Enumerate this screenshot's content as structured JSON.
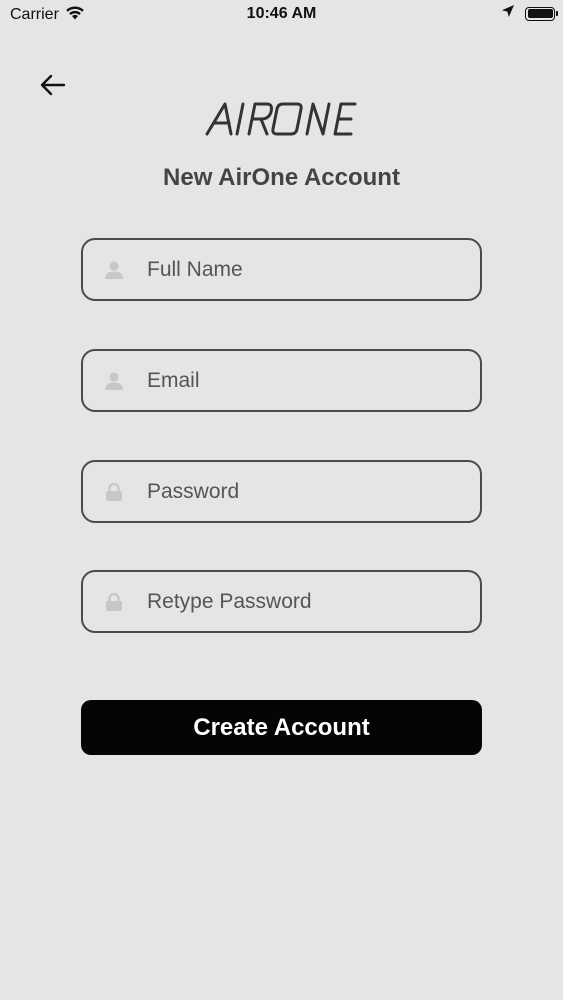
{
  "status_bar": {
    "carrier": "Carrier",
    "time": "10:46 AM",
    "wifi_icon": "wifi-icon",
    "location_icon": "location-arrow-icon",
    "battery_icon": "battery-full-icon"
  },
  "header": {
    "back_icon": "arrow-left-icon",
    "logo_text": "AIRONE",
    "title": "New AirOne Account"
  },
  "form": {
    "full_name": {
      "placeholder": "Full Name",
      "value": "",
      "icon": "user-icon"
    },
    "email": {
      "placeholder": "Email",
      "value": "",
      "icon": "user-icon"
    },
    "password": {
      "placeholder": "Password",
      "value": "",
      "icon": "lock-icon"
    },
    "retype_password": {
      "placeholder": "Retype Password",
      "value": "",
      "icon": "lock-icon"
    },
    "submit_label": "Create Account"
  },
  "colors": {
    "background": "#e6e4e7",
    "field_border": "#4a4a4a",
    "button_bg": "#050505",
    "button_text": "#ffffff",
    "icon_gray": "#c7c7c9"
  }
}
